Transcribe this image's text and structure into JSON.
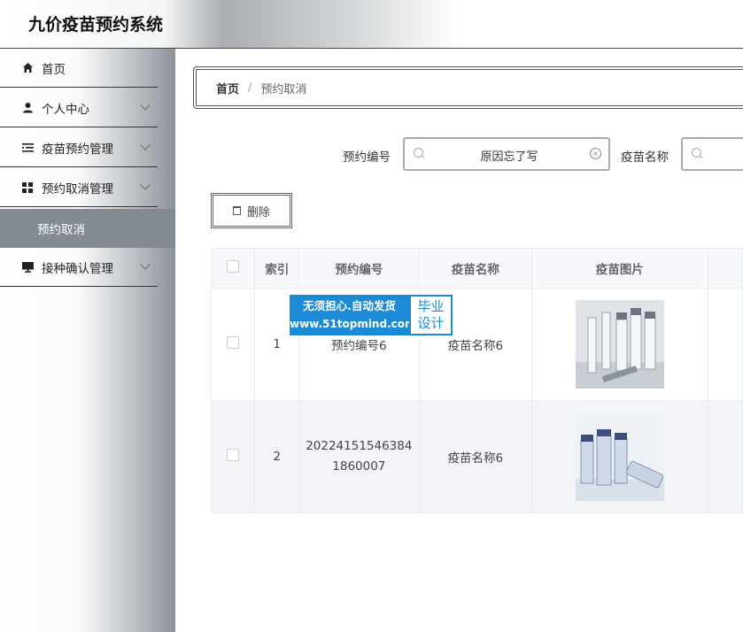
{
  "header": {
    "title": "九价疫苗预约系统"
  },
  "sidebar": {
    "items": [
      {
        "label": "首页",
        "icon": "home-icon",
        "has_children": false
      },
      {
        "label": "个人中心",
        "icon": "user-icon",
        "has_children": true
      },
      {
        "label": "疫苗预约管理",
        "icon": "list-icon",
        "has_children": true
      },
      {
        "label": "预约取消管理",
        "icon": "grid-icon",
        "has_children": true
      },
      {
        "label": "接种确认管理",
        "icon": "monitor-icon",
        "has_children": true
      }
    ],
    "active_sub_item": "预约取消"
  },
  "breadcrumb": {
    "home": "首页",
    "separator": "/",
    "current": "预约取消"
  },
  "search": {
    "field1_label": "预约编号",
    "field1_value": "原因忘了写",
    "field2_label": "疫苗名称",
    "field2_value": ""
  },
  "toolbar": {
    "delete_label": "删除"
  },
  "table": {
    "headers": [
      "索引",
      "预约编号",
      "疫苗名称",
      "疫苗图片"
    ],
    "rows": [
      {
        "index": "1",
        "code": "预约编号6",
        "vaccine": "疫苗名称6",
        "image": "vaccine-vials-photo"
      },
      {
        "index": "2",
        "code": "20224151546384\n1860007",
        "vaccine": "疫苗名称6",
        "image": "vaccine-vials-photo"
      }
    ]
  },
  "watermark": {
    "line1": "无须担心.自动发货",
    "line2": "www.51topmind.com",
    "badge1": "毕业",
    "badge2": "设计"
  },
  "colors": {
    "submenu_active_bg": "#838a91",
    "watermark_blue": "#1c8ad4"
  }
}
